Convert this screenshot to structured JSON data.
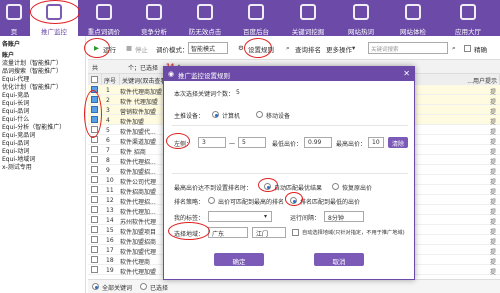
{
  "nav": [
    {
      "label": "页"
    },
    {
      "label": "推广监控"
    },
    {
      "label": "重点词调价"
    },
    {
      "label": "竞争分析"
    },
    {
      "label": "防无效点击"
    },
    {
      "label": "百度后台"
    },
    {
      "label": "关键词挖掘"
    },
    {
      "label": "网站热词"
    },
    {
      "label": "网站体检"
    },
    {
      "label": "应用大厅"
    }
  ],
  "sidebar": {
    "header": "各账户",
    "items": [
      "账户",
      "流量计划（智能推广）",
      "品词搜索（智能推广）",
      "Equi-代理",
      "优化计划（智能推广）",
      "Equi-竞品",
      "Equi-长词",
      "Equi-品词",
      "Equi-什么",
      "Equi-分析（智能推广）",
      "Equi-竞品词",
      "Equi-品词",
      "Equi-动词",
      "Equi-地域词",
      "x-测试专用"
    ]
  },
  "toolbar": {
    "run": "运行",
    "stop": "停止",
    "bid_mode_label": "调价模式：",
    "bid_mode_value": "智能模式",
    "settings": "设置规则",
    "rank": "查询排名",
    "more": "更多操作",
    "search_placeholder": "关键词搜索",
    "exact": "精确"
  },
  "tabs": {
    "summary_prefix": "共",
    "selected_prefix": "个；已选择",
    "selected_count": "14",
    "selected_suffix": "个"
  },
  "table": {
    "headers": [
      "序号",
      "关键词(双击查看...)",
      "...用户提示"
    ],
    "rows": [
      {
        "num": "1",
        "kw": "软件代理商加盟",
        "checked": true,
        "end": "提"
      },
      {
        "num": "2",
        "kw": "软件 代理加盟",
        "checked": true,
        "end": "提"
      },
      {
        "num": "3",
        "kw": "营销软件加盟",
        "checked": true,
        "end": "提"
      },
      {
        "num": "4",
        "kw": "软件加盟",
        "checked": true,
        "end": "提"
      },
      {
        "num": "5",
        "kw": "软件加盟代...",
        "checked": false,
        "end": "提"
      },
      {
        "num": "6",
        "kw": "软件渠道加盟",
        "checked": false,
        "end": "提"
      },
      {
        "num": "7",
        "kw": "软件 招商",
        "checked": false,
        "end": "提"
      },
      {
        "num": "8",
        "kw": "软件代理招...",
        "checked": false,
        "end": "提"
      },
      {
        "num": "9",
        "kw": "软件加盟招...",
        "checked": false,
        "end": "提"
      },
      {
        "num": "10",
        "kw": "软件公司代理",
        "checked": false,
        "end": "提"
      },
      {
        "num": "11",
        "kw": "软件招商加盟",
        "checked": false,
        "end": "提"
      },
      {
        "num": "12",
        "kw": "软件代理招...",
        "checked": false,
        "end": "提"
      },
      {
        "num": "13",
        "kw": "软件代理加...",
        "checked": false,
        "end": "提"
      },
      {
        "num": "14",
        "kw": "苏州软件代理",
        "checked": false,
        "end": "提"
      },
      {
        "num": "15",
        "kw": "软件加盟项目",
        "checked": false,
        "end": "提"
      },
      {
        "num": "16",
        "kw": "软件加盟招商",
        "checked": false,
        "end": "提"
      },
      {
        "num": "17",
        "kw": "软件加盟代理",
        "checked": false,
        "end": "提"
      },
      {
        "num": "18",
        "kw": "软件代理商",
        "checked": false,
        "end": "提"
      },
      {
        "num": "19",
        "kw": "软件代理加盟",
        "checked": false,
        "end": "提"
      }
    ]
  },
  "bottom": {
    "all_keywords": "全部关键词",
    "selected": "已选择"
  },
  "dialog": {
    "title": "推广监控设置规则",
    "count_label": "本次选择关键词个数：",
    "count_value": "5",
    "device_label": "主推设备：",
    "device_pc": "计算机",
    "device_mobile": "移动设备",
    "left_label": "左侧：",
    "rank_from": "3",
    "dash": "一",
    "rank_to": "5",
    "min_price_label": "最低出价：",
    "min_price": "0.99",
    "max_price_label": "最高出价：",
    "max_price": "10",
    "delete": "清除",
    "unreached_label": "最高出价达不到设置排名时：",
    "unreached_keep": "自动匹配最优结果",
    "unreached_restore": "恢复原出价",
    "strategy_label": "排名策略：",
    "strategy_a": "出价可匹配到最高的排名",
    "strategy_b": "排名匹配到最低的出价",
    "my_tag_label": "我的标签：",
    "run_period_label": "运行间隔：",
    "run_period_value": "8分钟",
    "region_label": "选择地域：",
    "province": "广东",
    "city": "江门",
    "auto_region": "自动选择地域(只针对指定，不用于推广地域)",
    "ok": "确定",
    "cancel": "取消"
  },
  "colors": {
    "brand": "#6b4aa8",
    "annotation": "#e02020"
  }
}
